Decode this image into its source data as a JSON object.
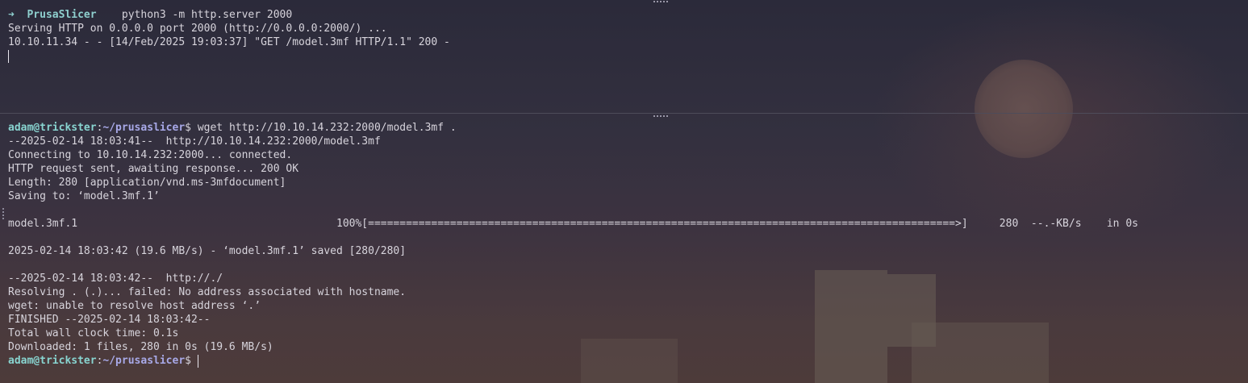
{
  "top_pane": {
    "prompt_symbol": "➜",
    "app_name": "PrusaSlicer",
    "command": "python3 -m http.server 2000",
    "lines": [
      "Serving HTTP on 0.0.0.0 port 2000 (http://0.0.0.0:2000/) ...",
      "10.10.11.34 - - [14/Feb/2025 19:03:37] \"GET /model.3mf HTTP/1.1\" 200 -"
    ]
  },
  "bottom_pane": {
    "user_host": "adam@trickster",
    "path": "~/prusaslicer",
    "prompt_suffix": "$",
    "command": "wget http://10.10.14.232:2000/model.3mf .",
    "lines_block1": [
      "--2025-02-14 18:03:41--  http://10.10.14.232:2000/model.3mf",
      "Connecting to 10.10.14.232:2000... connected.",
      "HTTP request sent, awaiting response... 200 OK",
      "Length: 280 [application/vnd.ms-3mfdocument]",
      "Saving to: ‘model.3mf.1’"
    ],
    "progress_line": "model.3mf.1                                         100%[=============================================================================================>]     280  --.-KB/s    in 0s",
    "saved_line": "2025-02-14 18:03:42 (19.6 MB/s) - ‘model.3mf.1’ saved [280/280]",
    "lines_block2": [
      "--2025-02-14 18:03:42--  http://./",
      "Resolving . (.)... failed: No address associated with hostname.",
      "wget: unable to resolve host address ‘.’",
      "FINISHED --2025-02-14 18:03:42--",
      "Total wall clock time: 0.1s",
      "Downloaded: 1 files, 280 in 0s (19.6 MB/s)"
    ],
    "final_prompt": {
      "user_host": "adam@trickster",
      "path": "~/prusaslicer",
      "suffix": "$"
    }
  }
}
